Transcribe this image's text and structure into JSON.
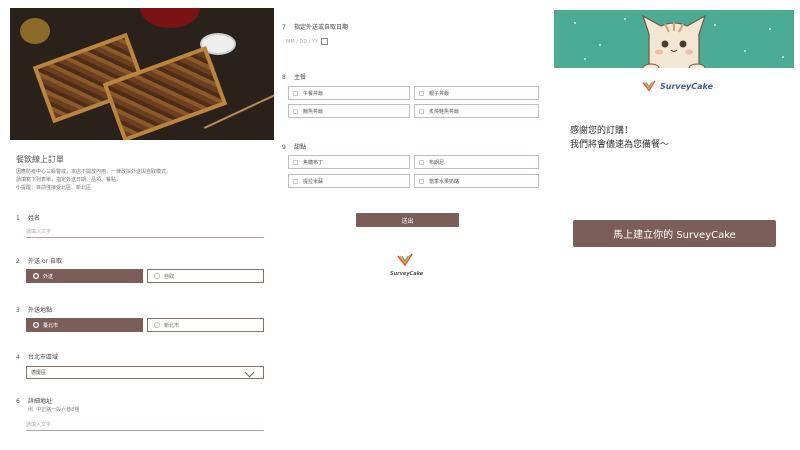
{
  "form": {
    "title": "餐飲線上訂單",
    "description": "因應防疫中心三級警戒，本店不開放內用，一律改採外送與自取模式。\n請填寫下列表單，指定外送日期、品項、餐點。\n小提醒：目前僅接受北區、新北區",
    "questions": {
      "q1": {
        "num": "1",
        "label": "姓名",
        "placeholder": "請填入文字"
      },
      "q2": {
        "num": "2",
        "label": "外送 or 自取",
        "options": [
          "外送",
          "自取"
        ],
        "selected": "外送"
      },
      "q3": {
        "num": "3",
        "label": "外送地點",
        "options": [
          "臺北市",
          "新北市"
        ],
        "selected": "臺北市"
      },
      "q4": {
        "num": "4",
        "label": "台北市區域",
        "value": "德慶區"
      },
      "q6": {
        "num": "6",
        "label": "詳細地址",
        "hint": "例. 中正路一段六巷8樓",
        "placeholder": "請填入文字"
      },
      "q7": {
        "num": "7",
        "label": "指定外送或自取日期",
        "placeholder": "MM / DD / YY"
      },
      "q8": {
        "num": "8",
        "label": "主餐",
        "options": [
          "午餐丼飯",
          "親子丼飯",
          "鰻魚丼飯",
          "炙燒鮭魚丼飯"
        ]
      },
      "q9": {
        "num": "9",
        "label": "甜點",
        "options": [
          "焦糖布丁",
          "布朗尼",
          "提拉米蘇",
          "當季水果奶酪"
        ]
      }
    },
    "submit_label": "送出",
    "powered_by": "SurveyCake"
  },
  "thanks": {
    "brand": "SurveyCake",
    "message": "感謝您的訂購！\n我們將會儘速為您備餐～",
    "cta_label": "馬上建立你的 SurveyCake"
  },
  "colors": {
    "accent": "#7b5e57",
    "banner": "#4bab93",
    "brand_blue": "#3e5d8a"
  }
}
